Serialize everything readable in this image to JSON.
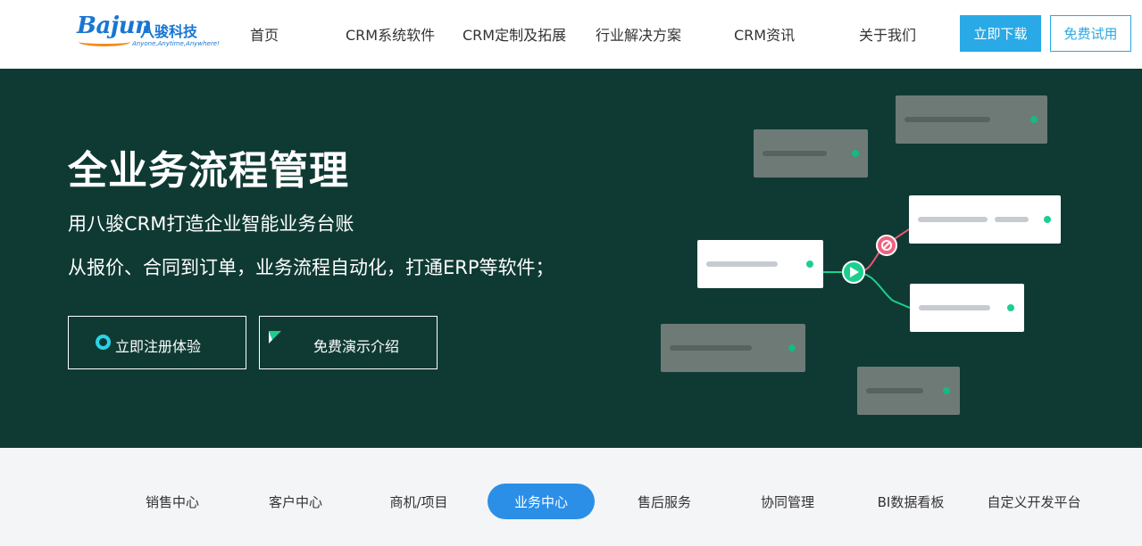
{
  "header": {
    "logo": {
      "brand": "Bajun",
      "cn": "八骏科技",
      "slogan": "Anyone,Anytime,Anywhere!"
    },
    "nav": [
      {
        "label": "首页"
      },
      {
        "label": "CRM系统软件"
      },
      {
        "label": "CRM定制及拓展"
      },
      {
        "label": "行业解决方案"
      },
      {
        "label": "CRM资讯"
      },
      {
        "label": "关于我们"
      }
    ],
    "download_label": "立即下载",
    "trial_label": "免费试用"
  },
  "hero": {
    "title": "全业务流程管理",
    "subtitle1": "用八骏CRM打造企业智能业务台账",
    "subtitle2": "从报价、合同到订单，业务流程自动化，打通ERP等软件；",
    "register_label": "立即注册体验",
    "demo_label": "免费演示介绍"
  },
  "tabs": [
    {
      "label": "销售中心",
      "active": false
    },
    {
      "label": "客户中心",
      "active": false
    },
    {
      "label": "商机/项目",
      "active": false
    },
    {
      "label": "业务中心",
      "active": true
    },
    {
      "label": "售后服务",
      "active": false
    },
    {
      "label": "协同管理",
      "active": false
    },
    {
      "label": "BI数据看板",
      "active": false
    },
    {
      "label": "自定义开发平台",
      "active": false
    }
  ],
  "colors": {
    "hero_bg": "#0f3a33",
    "accent_blue": "#29a9e6",
    "active_tab": "#2b8fe8",
    "node_green": "#1ccf8e",
    "block_icon": "#f0627f"
  }
}
